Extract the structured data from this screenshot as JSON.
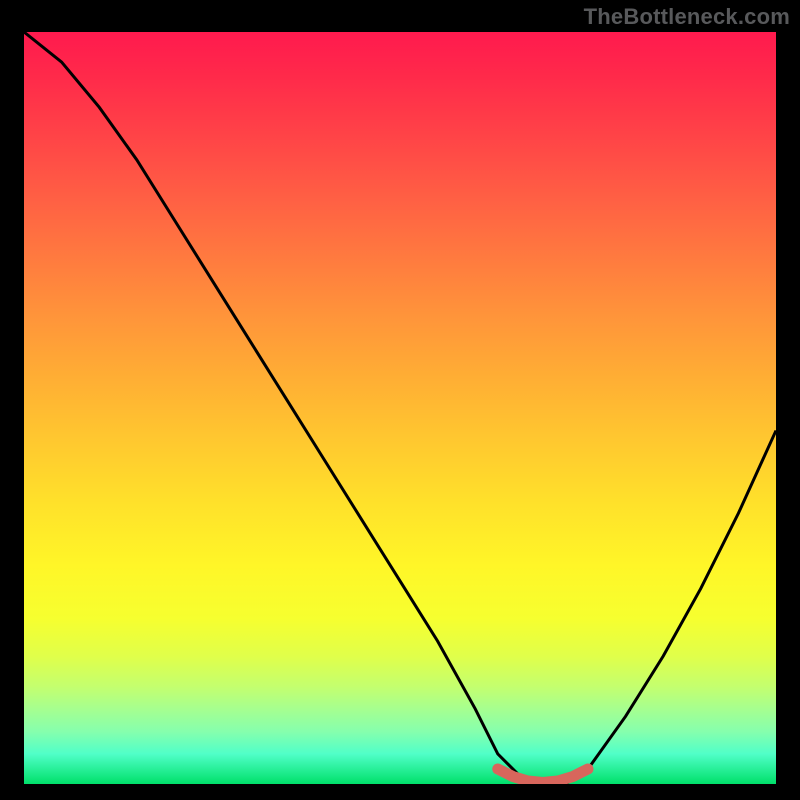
{
  "watermark": {
    "text": "TheBottleneck.com"
  },
  "colors": {
    "background": "#000000",
    "curve": "#000000",
    "highlight": "#d8665c",
    "watermark": "#58595b"
  },
  "chart_data": {
    "type": "line",
    "title": "",
    "xlabel": "",
    "ylabel": "",
    "xlim": [
      0,
      100
    ],
    "ylim": [
      0,
      100
    ],
    "grid": false,
    "series": [
      {
        "name": "bottleneck-curve",
        "x": [
          0,
          5,
          10,
          15,
          20,
          25,
          30,
          35,
          40,
          45,
          50,
          55,
          60,
          63,
          66,
          69,
          72,
          75,
          80,
          85,
          90,
          95,
          100
        ],
        "y": [
          100,
          96,
          90,
          83,
          75,
          67,
          59,
          51,
          43,
          35,
          27,
          19,
          10,
          4,
          1,
          0,
          0,
          2,
          9,
          17,
          26,
          36,
          47
        ]
      }
    ],
    "highlight": {
      "name": "optimal-range",
      "x_range": [
        63,
        75
      ],
      "x": [
        63,
        65,
        67,
        69,
        71,
        73,
        75
      ],
      "y": [
        2.0,
        1.0,
        0.4,
        0.2,
        0.4,
        1.0,
        2.0
      ],
      "stroke_width": 10,
      "color": "#d8665c"
    }
  }
}
